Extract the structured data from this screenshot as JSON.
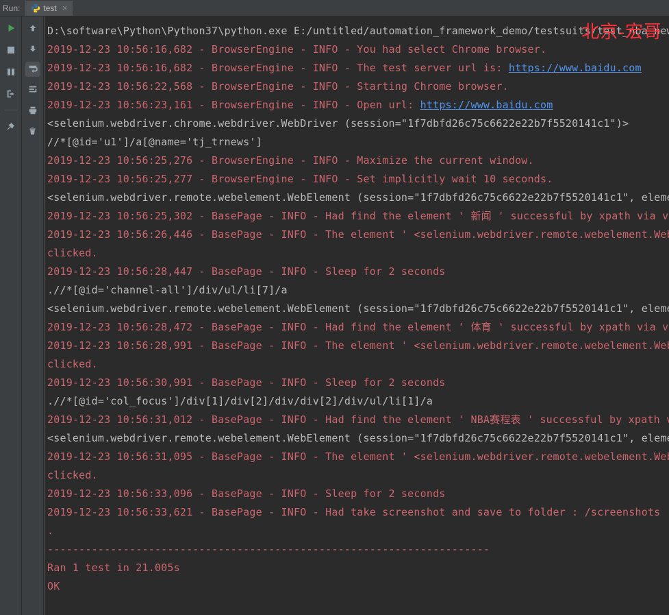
{
  "topbar": {
    "run_label": "Run:",
    "tab_name": "test",
    "tab_close": "×"
  },
  "watermark": "北京-宏哥",
  "lines": [
    {
      "class": "plain",
      "text": "D:\\software\\Python\\Python37\\python.exe E:/untitled/automation_framework_demo/testsuits/test_nba_news"
    },
    {
      "class": "red",
      "text": "2019-12-23 10:56:16,682 - BrowserEngine - INFO - You had select Chrome browser."
    },
    {
      "class": "red",
      "text": "2019-12-23 10:56:16,682 - BrowserEngine - INFO - The test server url is: ",
      "link": "https://www.baidu.com"
    },
    {
      "class": "red",
      "text": "2019-12-23 10:56:22,568 - BrowserEngine - INFO - Starting Chrome browser."
    },
    {
      "class": "red",
      "text": "2019-12-23 10:56:23,161 - BrowserEngine - INFO - Open url: ",
      "link": "https://www.baidu.com"
    },
    {
      "class": "plain",
      "text": "<selenium.webdriver.chrome.webdriver.WebDriver (session=\"1f7dbfd26c75c6622e22b7f5520141c1\")>"
    },
    {
      "class": "plain",
      "text": "//*[@id='u1']/a[@name='tj_trnews']"
    },
    {
      "class": "red",
      "text": "2019-12-23 10:56:25,276 - BrowserEngine - INFO - Maximize the current window."
    },
    {
      "class": "red",
      "text": "2019-12-23 10:56:25,277 - BrowserEngine - INFO - Set implicitly wait 10 seconds."
    },
    {
      "class": "plain",
      "text": "<selenium.webdriver.remote.webelement.WebElement (session=\"1f7dbfd26c75c6622e22b7f5520141c1\", elemen"
    },
    {
      "class": "red",
      "text": "2019-12-23 10:56:25,302 - BasePage - INFO - Had find the element ' 新闻 ' successful by xpath via va"
    },
    {
      "class": "red",
      "text": "2019-12-23 10:56:26,446 - BasePage - INFO - The element ' <selenium.webdriver.remote.webelement.WebE"
    },
    {
      "class": "red",
      "text": " clicked."
    },
    {
      "class": "red",
      "text": "2019-12-23 10:56:28,447 - BasePage - INFO - Sleep for 2 seconds"
    },
    {
      "class": "plain",
      "text": ".//*[@id='channel-all']/div/ul/li[7]/a"
    },
    {
      "class": "plain",
      "text": "<selenium.webdriver.remote.webelement.WebElement (session=\"1f7dbfd26c75c6622e22b7f5520141c1\", elemen"
    },
    {
      "class": "red",
      "text": "2019-12-23 10:56:28,472 - BasePage - INFO - Had find the element ' 体育 ' successful by xpath via va"
    },
    {
      "class": "red",
      "text": "2019-12-23 10:56:28,991 - BasePage - INFO - The element ' <selenium.webdriver.remote.webelement.WebE"
    },
    {
      "class": "red",
      "text": " clicked."
    },
    {
      "class": "red",
      "text": "2019-12-23 10:56:30,991 - BasePage - INFO - Sleep for 2 seconds"
    },
    {
      "class": "plain",
      "text": ".//*[@id='col_focus']/div[1]/div[2]/div/div[2]/div/ul/li[1]/a"
    },
    {
      "class": "red",
      "text": "2019-12-23 10:56:31,012 - BasePage - INFO - Had find the element ' NBA赛程表 ' successful by xpath v"
    },
    {
      "class": "plain",
      "text": "<selenium.webdriver.remote.webelement.WebElement (session=\"1f7dbfd26c75c6622e22b7f5520141c1\", elemen"
    },
    {
      "class": "red",
      "text": "2019-12-23 10:56:31,095 - BasePage - INFO - The element ' <selenium.webdriver.remote.webelement.WebE"
    },
    {
      "class": "red",
      "text": " clicked."
    },
    {
      "class": "red",
      "text": "2019-12-23 10:56:33,096 - BasePage - INFO - Sleep for 2 seconds"
    },
    {
      "class": "red",
      "text": "2019-12-23 10:56:33,621 - BasePage - INFO - Had take screenshot and save to folder : /screenshots"
    },
    {
      "class": "red",
      "text": "."
    },
    {
      "class": "red",
      "text": "----------------------------------------------------------------------"
    },
    {
      "class": "red",
      "text": "Ran 1 test in 21.005s"
    },
    {
      "class": "red",
      "text": ""
    },
    {
      "class": "red",
      "text": "OK"
    }
  ]
}
